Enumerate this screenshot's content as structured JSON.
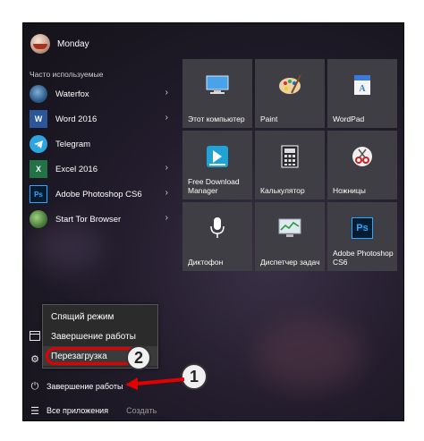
{
  "user": {
    "name": "Monday"
  },
  "section_title": "Часто используемые",
  "apps": [
    {
      "label": "Waterfox",
      "icon": "waterfox-icon",
      "color": "#2e5d8a"
    },
    {
      "label": "Word 2016",
      "icon": "word-icon",
      "color": "#2b579a",
      "glyph": "W"
    },
    {
      "label": "Telegram",
      "icon": "telegram-icon",
      "color": "#2ca5e0"
    },
    {
      "label": "Excel 2016",
      "icon": "excel-icon",
      "color": "#217346",
      "glyph": "X"
    },
    {
      "label": "Adobe Photoshop CS6",
      "icon": "photoshop-icon",
      "color": "#001d34",
      "glyph": "Ps"
    },
    {
      "label": "Start Tor Browser",
      "icon": "tor-browser-icon",
      "color": "#4a7d3a"
    }
  ],
  "tiles": [
    {
      "label": "Этот компьютер",
      "icon": "this-pc-icon"
    },
    {
      "label": "Paint",
      "icon": "paint-icon"
    },
    {
      "label": "WordPad",
      "icon": "wordpad-icon"
    },
    {
      "label": "Free Download Manager",
      "icon": "download-manager-icon"
    },
    {
      "label": "Калькулятор",
      "icon": "calculator-icon"
    },
    {
      "label": "Ножницы",
      "icon": "scissors-icon"
    },
    {
      "label": "Диктофон",
      "icon": "microphone-icon"
    },
    {
      "label": "Диспетчер задач",
      "icon": "task-manager-icon"
    },
    {
      "label": "Adobe Photoshop CS6",
      "icon": "photoshop-icon",
      "glyph": "Ps"
    }
  ],
  "power_menu": {
    "items": [
      "Спящий режим",
      "Завершение работы",
      "Перезагрузка"
    ]
  },
  "power_button_label": "Завершение работы",
  "all_apps_label": "Все приложения",
  "create_label": "Создать",
  "annotations": {
    "step1": "1",
    "step2": "2"
  },
  "colors": {
    "tile": "#3e3e44",
    "highlight": "#e30000"
  }
}
